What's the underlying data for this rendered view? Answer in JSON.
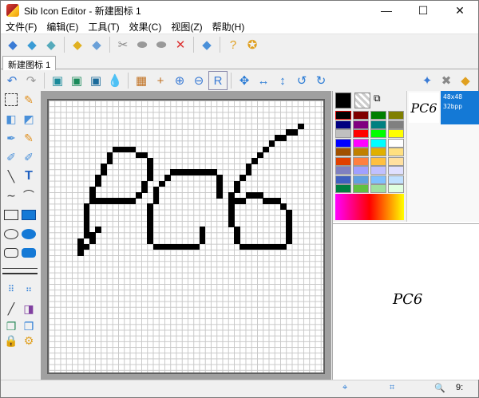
{
  "window": {
    "title": "Sib Icon Editor - 新建图标 1",
    "min": "—",
    "max": "☐",
    "close": "✕"
  },
  "menu": [
    "文件(F)",
    "编辑(E)",
    "工具(T)",
    "效果(C)",
    "视图(Z)",
    "帮助(H)"
  ],
  "tab": {
    "label": "新建图标",
    "close": "1"
  },
  "preview": {
    "thumb_text": "PC6",
    "size": "48x48",
    "depth": "32bpp",
    "large_text": "PC6"
  },
  "status": {
    "zoom_label": "9:"
  },
  "colors": {
    "current": "#000000",
    "palette": [
      "#000000",
      "#800000",
      "#008000",
      "#808000",
      "#000080",
      "#800080",
      "#008080",
      "#808080",
      "#c0c0c0",
      "#ff0000",
      "#00ff00",
      "#ffff00",
      "#0000ff",
      "#ff00ff",
      "#00ffff",
      "#ffffff",
      "#a05000",
      "#c08000",
      "#e0b000",
      "#ffe080",
      "#e04000",
      "#ff8040",
      "#ffc040",
      "#ffe0a0",
      "#8080c0",
      "#a0a0ff",
      "#c0c0ff",
      "#e0e0ff",
      "#4060c0",
      "#60a0e0",
      "#80c0ff",
      "#c0e0ff",
      "#008040",
      "#60c040",
      "#a0e0a0",
      "#e0ffe0"
    ]
  },
  "icons": {
    "toolbar": [
      "new-icon",
      "open-icon",
      "save-icon",
      "save-as-icon",
      "add-image-icon",
      "import-icon",
      "cut-icon",
      "copy-icon",
      "paste-icon",
      "delete-icon",
      "options-icon",
      "help-icon",
      "about-icon"
    ],
    "tools": [
      "undo-icon",
      "redo-icon",
      "layer-icon",
      "layer2-icon",
      "layer3-icon",
      "drop-icon",
      "grid-icon",
      "cross-icon",
      "zoom-in-icon",
      "zoom-out-icon",
      "zoom-fit-icon",
      "move-icon",
      "left-right-icon",
      "up-down-icon",
      "rotate-left-icon",
      "rotate-right-icon"
    ]
  }
}
